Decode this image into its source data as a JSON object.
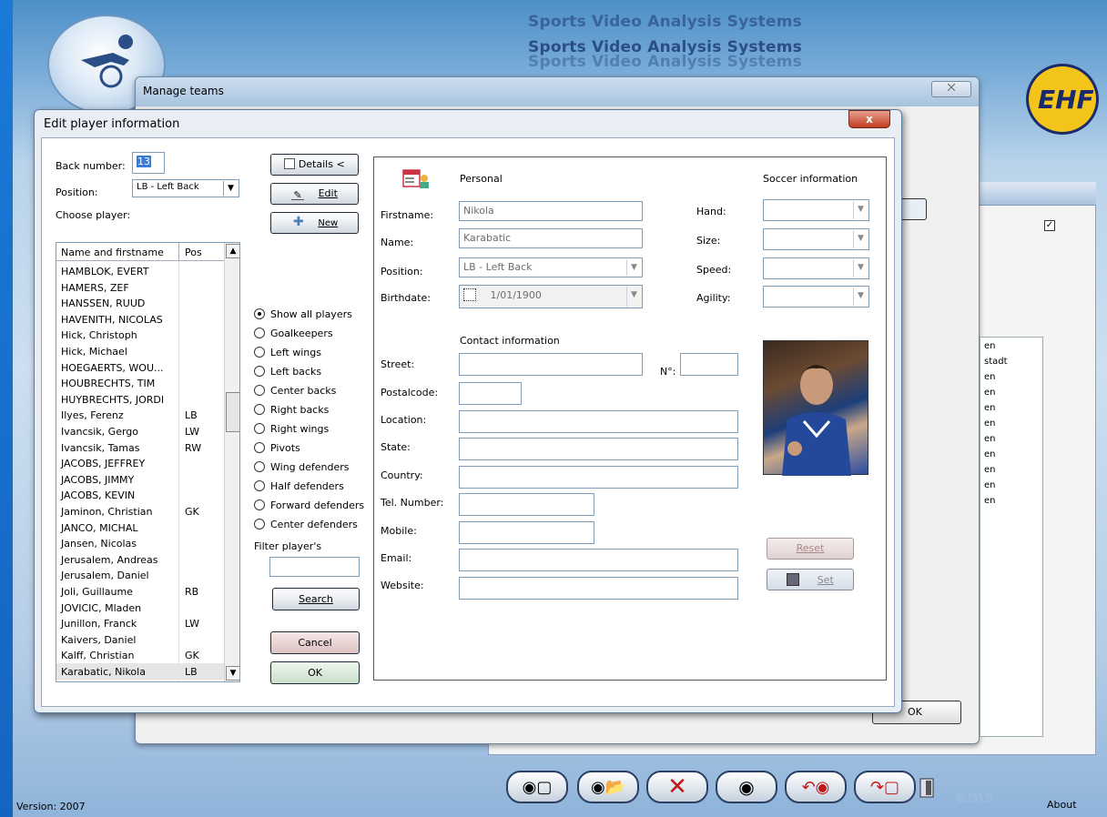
{
  "app": {
    "brand_lines": [
      "Sports Video Analysis Systems",
      "Sports Video Analysis Systems",
      "Sports Video Analysis Systems"
    ],
    "logo_text": "EHF",
    "version": "Version: 2007",
    "about": "About",
    "brand_bottom": "ems"
  },
  "manage_teams": {
    "title": "Manage teams",
    "close": "⨉",
    "ok": "OK",
    "list_items": [
      "en",
      "stadt",
      "en",
      "en",
      "en",
      "en",
      "en",
      "en",
      "en",
      "en",
      "en"
    ]
  },
  "dialog": {
    "title": "Edit player information",
    "close": "x",
    "back_number_label": "Back number:",
    "back_number_value": "13",
    "position_label": "Position:",
    "position_value": "LB - Left Back",
    "choose_player_label": "Choose player:",
    "buttons": {
      "details": "Details <",
      "edit": "Edit",
      "new": "New",
      "search": "Search",
      "cancel": "Cancel",
      "ok": "OK",
      "reset": "Reset",
      "set": "Set"
    },
    "list": {
      "col_name": "Name and firstname",
      "col_pos": "Pos",
      "rows": [
        {
          "name": "HAMBLOK, EVERT",
          "pos": ""
        },
        {
          "name": "HAMERS, ZEF",
          "pos": ""
        },
        {
          "name": "HANSSEN, RUUD",
          "pos": ""
        },
        {
          "name": "HAVENITH, NICOLAS",
          "pos": ""
        },
        {
          "name": "Hick, Christoph",
          "pos": ""
        },
        {
          "name": "Hick, Michael",
          "pos": ""
        },
        {
          "name": "HOEGAERTS, WOU...",
          "pos": ""
        },
        {
          "name": "HOUBRECHTS, TIM",
          "pos": ""
        },
        {
          "name": "HUYBRECHTS, JORDI",
          "pos": ""
        },
        {
          "name": "Ilyes, Ferenz",
          "pos": "LB"
        },
        {
          "name": "Ivancsik, Gergo",
          "pos": "LW"
        },
        {
          "name": "Ivancsik, Tamas",
          "pos": "RW"
        },
        {
          "name": "JACOBS, JEFFREY",
          "pos": ""
        },
        {
          "name": "JACOBS, JIMMY",
          "pos": ""
        },
        {
          "name": "JACOBS, KEVIN",
          "pos": ""
        },
        {
          "name": "Jaminon, Christian",
          "pos": "GK"
        },
        {
          "name": "JANCO, MICHAL",
          "pos": ""
        },
        {
          "name": "Jansen, Nicolas",
          "pos": ""
        },
        {
          "name": "Jerusalem, Andreas",
          "pos": ""
        },
        {
          "name": "Jerusalem, Daniel",
          "pos": ""
        },
        {
          "name": "Joli, Guillaume",
          "pos": "RB"
        },
        {
          "name": "JOVICIC, Mladen",
          "pos": ""
        },
        {
          "name": "Junillon, Franck",
          "pos": "LW"
        },
        {
          "name": "Kaivers, Daniel",
          "pos": ""
        },
        {
          "name": "Kalff, Christian",
          "pos": "GK"
        },
        {
          "name": "Karabatic, Nikola",
          "pos": "LB"
        }
      ]
    },
    "filters": [
      {
        "label": "Show all players",
        "selected": true
      },
      {
        "label": "Goalkeepers",
        "selected": false
      },
      {
        "label": "Left wings",
        "selected": false
      },
      {
        "label": "Left backs",
        "selected": false
      },
      {
        "label": "Center backs",
        "selected": false
      },
      {
        "label": "Right backs",
        "selected": false
      },
      {
        "label": "Right wings",
        "selected": false
      },
      {
        "label": "Pivots",
        "selected": false
      },
      {
        "label": "Wing defenders",
        "selected": false
      },
      {
        "label": "Half defenders",
        "selected": false
      },
      {
        "label": "Forward defenders",
        "selected": false
      },
      {
        "label": "Center defenders",
        "selected": false
      }
    ],
    "filter_players_label": "Filter player's",
    "filter_value": "",
    "personal": {
      "heading": "Personal",
      "firstname_label": "Firstname:",
      "firstname": "Nikola",
      "name_label": "Name:",
      "name": "Karabatic",
      "position_label": "Position:",
      "position": "LB - Left Back",
      "birthdate_label": "Birthdate:",
      "birthdate": "1/01/1900"
    },
    "soccer": {
      "heading": "Soccer information",
      "hand_label": "Hand:",
      "size_label": "Size:",
      "speed_label": "Speed:",
      "agility_label": "Agility:"
    },
    "contact": {
      "heading": "Contact information",
      "street_label": "Street:",
      "number_label": "N°:",
      "postalcode_label": "Postalcode:",
      "location_label": "Location:",
      "state_label": "State:",
      "country_label": "Country:",
      "tel_label": "Tel. Number:",
      "mobile_label": "Mobile:",
      "email_label": "Email:",
      "website_label": "Website:"
    }
  },
  "colors": {
    "accent": "#1565c0",
    "close_red": "#c23b1f",
    "brand_blue": "#2b4e86"
  }
}
